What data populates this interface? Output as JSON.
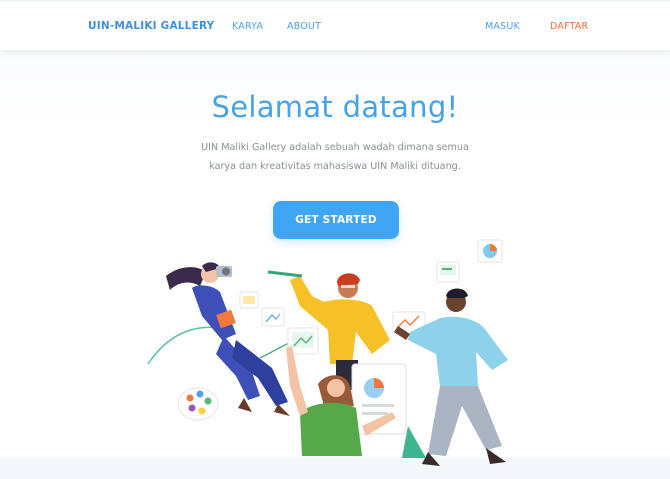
{
  "nav": {
    "brand": "UIN-MALIKI GALLERY",
    "links": [
      {
        "label": "KARYA"
      },
      {
        "label": "ABOUT"
      }
    ],
    "auth": {
      "login": "MASUK",
      "register": "DAFTAR"
    }
  },
  "hero": {
    "title": "Selamat datang!",
    "description_line1": "UIN Maliki Gallery adalah sebuah wadah dimana semua",
    "description_line2": "karya dan kreativitas mahasiswa UIN Maliki dituang.",
    "cta": "GET STARTED"
  },
  "colors": {
    "brand": "#3f8fe0",
    "link": "#4aa3ee",
    "register": "#f0703c",
    "cta_bg": "#41a5f5",
    "title": "#47a2e6"
  }
}
